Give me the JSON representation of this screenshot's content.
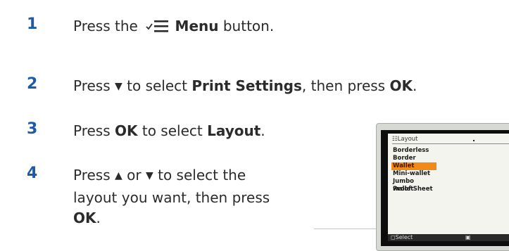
{
  "steps": [
    {
      "number": "1",
      "parts": {
        "a": "Press the ",
        "b": "Menu",
        "c": " button."
      }
    },
    {
      "number": "2",
      "parts": {
        "a": "Press ",
        "tri": "▼",
        "b": " to select ",
        "c": "Print Settings",
        "d": ", then press ",
        "e": "OK",
        "f": "."
      }
    },
    {
      "number": "3",
      "parts": {
        "a": "Press ",
        "b": "OK",
        "c": " to select ",
        "d": "Layout",
        "e": "."
      }
    },
    {
      "number": "4",
      "line1": {
        "a": "Press ",
        "up": "▲",
        "b": " or ",
        "down": "▼",
        "c": " to select the"
      },
      "line2": "layout you want, then press",
      "line3": "OK",
      "line3_end": "."
    }
  ],
  "screen": {
    "title": "Layout",
    "options": [
      "Borderless",
      "Border",
      "Wallet",
      "Mini-wallet",
      "Jumbo wallet",
      "Proof Sheet"
    ],
    "selected_index": 2,
    "footer_left": "Select",
    "footer_right": "",
    "highlight_color": "#f28a1a"
  },
  "colors": {
    "step_number": "#1f5aa6",
    "text": "#2b2b2b"
  }
}
